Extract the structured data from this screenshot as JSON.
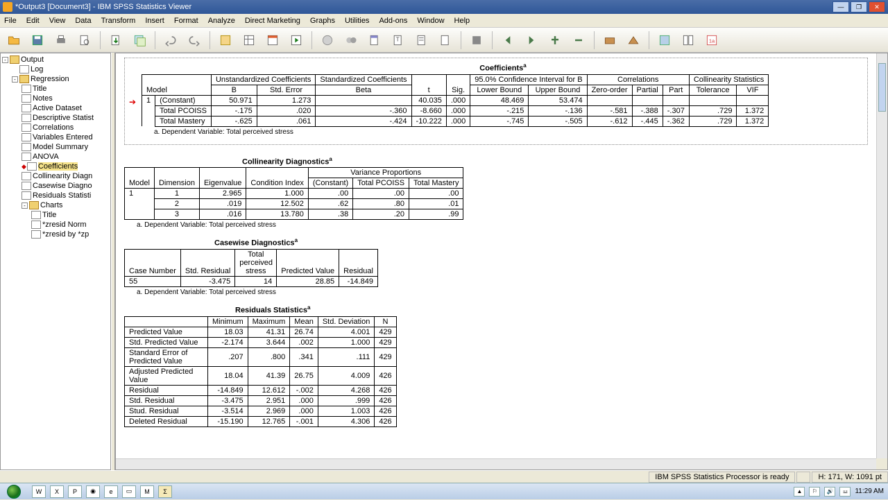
{
  "window": {
    "title": "*Output3 [Document3] - IBM SPSS Statistics Viewer"
  },
  "menus": [
    "File",
    "Edit",
    "View",
    "Data",
    "Transform",
    "Insert",
    "Format",
    "Analyze",
    "Direct Marketing",
    "Graphs",
    "Utilities",
    "Add-ons",
    "Window",
    "Help"
  ],
  "tree": {
    "root": "Output",
    "log": "Log",
    "regression": "Regression",
    "items": [
      "Title",
      "Notes",
      "Active Dataset",
      "Descriptive Statist",
      "Correlations",
      "Variables Entered",
      "Model Summary",
      "ANOVA",
      "Coefficients",
      "Collinearity Diagn",
      "Casewise Diagno",
      "Residuals Statisti"
    ],
    "charts": "Charts",
    "chart_items": [
      "Title",
      "*zresid Norm",
      "*zresid by *zp"
    ]
  },
  "coefficients": {
    "title": "Coefficients",
    "headers": {
      "model": "Model",
      "unstd": "Unstandardized Coefficients",
      "std": "Standardized Coefficients",
      "b": "B",
      "stderr": "Std. Error",
      "beta": "Beta",
      "t": "t",
      "sig": "Sig.",
      "ci": "95.0% Confidence Interval for B",
      "lower": "Lower Bound",
      "upper": "Upper Bound",
      "corr": "Correlations",
      "zero": "Zero-order",
      "partial": "Partial",
      "part": "Part",
      "collin": "Collinearity Statistics",
      "tol": "Tolerance",
      "vif": "VIF"
    },
    "rows": [
      {
        "m": "1",
        "name": "(Constant)",
        "b": "50.971",
        "se": "1.273",
        "beta": "",
        "t": "40.035",
        "sig": ".000",
        "lo": "48.469",
        "up": "53.474",
        "zo": "",
        "pa": "",
        "pt": "",
        "tol": "",
        "vif": ""
      },
      {
        "m": "",
        "name": "Total PCOISS",
        "b": "-.175",
        "se": ".020",
        "beta": "-.360",
        "t": "-8.660",
        "sig": ".000",
        "lo": "-.215",
        "up": "-.136",
        "zo": "-.581",
        "pa": "-.388",
        "pt": "-.307",
        "tol": ".729",
        "vif": "1.372"
      },
      {
        "m": "",
        "name": "Total Mastery",
        "b": "-.625",
        "se": ".061",
        "beta": "-.424",
        "t": "-10.222",
        "sig": ".000",
        "lo": "-.745",
        "up": "-.505",
        "zo": "-.612",
        "pa": "-.445",
        "pt": "-.362",
        "tol": ".729",
        "vif": "1.372"
      }
    ],
    "footnote": "a. Dependent Variable: Total perceived stress"
  },
  "collinearity": {
    "title": "Collinearity Diagnostics",
    "headers": {
      "model": "Model",
      "dim": "Dimension",
      "eigen": "Eigenvalue",
      "cond": "Condition Index",
      "varprop": "Variance Proportions",
      "const": "(Constant)",
      "pcoiss": "Total PCOISS",
      "mastery": "Total Mastery"
    },
    "rows": [
      {
        "m": "1",
        "d": "1",
        "e": "2.965",
        "ci": "1.000",
        "c": ".00",
        "p": ".00",
        "ma": ".00"
      },
      {
        "m": "",
        "d": "2",
        "e": ".019",
        "ci": "12.502",
        "c": ".62",
        "p": ".80",
        "ma": ".01"
      },
      {
        "m": "",
        "d": "3",
        "e": ".016",
        "ci": "13.780",
        "c": ".38",
        "p": ".20",
        "ma": ".99"
      }
    ],
    "footnote": "a. Dependent Variable: Total perceived stress"
  },
  "casewise": {
    "title": "Casewise Diagnostics",
    "headers": {
      "case": "Case Number",
      "stdres": "Std. Residual",
      "tps": "Total perceived stress",
      "pred": "Predicted Value",
      "res": "Residual"
    },
    "rows": [
      {
        "c": "55",
        "sr": "-3.475",
        "tps": "14",
        "pv": "28.85",
        "r": "-14.849"
      }
    ],
    "footnote": "a. Dependent Variable: Total perceived stress"
  },
  "residuals": {
    "title": "Residuals Statistics",
    "headers": {
      "blank": "",
      "min": "Minimum",
      "max": "Maximum",
      "mean": "Mean",
      "sd": "Std. Deviation",
      "n": "N"
    },
    "rows": [
      {
        "l": "Predicted Value",
        "min": "18.03",
        "max": "41.31",
        "mean": "26.74",
        "sd": "4.001",
        "n": "429"
      },
      {
        "l": "Std. Predicted Value",
        "min": "-2.174",
        "max": "3.644",
        "mean": ".002",
        "sd": "1.000",
        "n": "429"
      },
      {
        "l": "Standard Error of Predicted Value",
        "min": ".207",
        "max": ".800",
        "mean": ".341",
        "sd": ".111",
        "n": "429"
      },
      {
        "l": "Adjusted Predicted Value",
        "min": "18.04",
        "max": "41.39",
        "mean": "26.75",
        "sd": "4.009",
        "n": "426"
      },
      {
        "l": "Residual",
        "min": "-14.849",
        "max": "12.612",
        "mean": "-.002",
        "sd": "4.268",
        "n": "426"
      },
      {
        "l": "Std. Residual",
        "min": "-3.475",
        "max": "2.951",
        "mean": ".000",
        "sd": ".999",
        "n": "426"
      },
      {
        "l": "Stud. Residual",
        "min": "-3.514",
        "max": "2.969",
        "mean": ".000",
        "sd": "1.003",
        "n": "426"
      },
      {
        "l": "Deleted Residual",
        "min": "-15.190",
        "max": "12.765",
        "mean": "-.001",
        "sd": "4.306",
        "n": "426"
      }
    ]
  },
  "status": {
    "processor": "IBM SPSS Statistics Processor is ready",
    "dims": "H: 171, W: 1091 pt"
  },
  "clock": "11:29 AM"
}
